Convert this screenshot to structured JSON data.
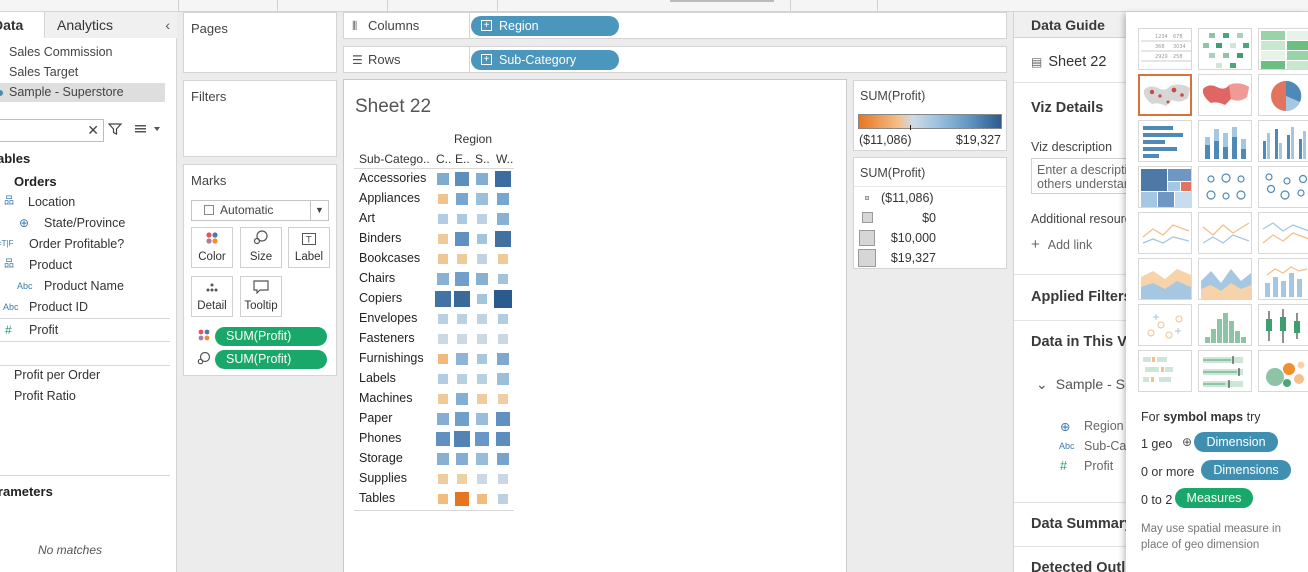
{
  "left_panel": {
    "tab_data": "Data",
    "tab_analytics": "Analytics",
    "datasources": [
      "Sales Commission",
      "Sales Target",
      "Sample - Superstore"
    ],
    "tables_heading": "Tables",
    "orders": "Orders",
    "fields": [
      {
        "label": "Location",
        "icon": "hierarchy-icon"
      },
      {
        "label": "State/Province",
        "icon": "globe-icon"
      },
      {
        "label": "Order Profitable?",
        "icon": "calc-dimension-icon"
      },
      {
        "label": "Product",
        "icon": "hierarchy-icon"
      },
      {
        "label": "Product Name",
        "icon": "abc-icon"
      },
      {
        "label": "Product ID",
        "icon": "abc-icon"
      },
      {
        "label": "Profit",
        "icon": "hash-icon"
      }
    ],
    "measures": [
      "Profit per Order",
      "Profit Ratio"
    ],
    "parameters_heading": "Parameters",
    "no_matches": "No matches"
  },
  "cards": {
    "pages": "Pages",
    "filters": "Filters",
    "marks": "Marks",
    "mark_type": "Automatic",
    "buttons": [
      "Color",
      "Size",
      "Label",
      "Detail",
      "Tooltip"
    ],
    "pills": [
      "SUM(Profit)",
      "SUM(Profit)"
    ]
  },
  "shelves": {
    "columns_label": "Columns",
    "columns_pill": "Region",
    "rows_label": "Rows",
    "rows_pill": "Sub-Category"
  },
  "sheet": {
    "title": "Sheet 22",
    "column_header": "Region",
    "row_header": "Sub-Catego..",
    "col_labels": [
      "C..",
      "E..",
      "S..",
      "W.."
    ]
  },
  "chart_data": {
    "type": "heatmap",
    "title": "Sheet 22",
    "xlabel": "Region",
    "ylabel": "Sub-Catego..",
    "columns": [
      "C..",
      "E..",
      "S..",
      "W.."
    ],
    "rows": [
      "Accessories",
      "Appliances",
      "Art",
      "Binders",
      "Bookcases",
      "Chairs",
      "Copiers",
      "Envelopes",
      "Fasteners",
      "Furnishings",
      "Labels",
      "Machines",
      "Paper",
      "Phones",
      "Storage",
      "Supplies",
      "Tables"
    ],
    "values": [
      [
        7300,
        11500,
        7000,
        16500
      ],
      [
        -2500,
        8000,
        4500,
        8000
      ],
      [
        2500,
        3000,
        1500,
        6500
      ],
      [
        -1500,
        11000,
        3900,
        16000
      ],
      [
        -1800,
        -1200,
        1300,
        -1500
      ],
      [
        6500,
        9000,
        6600,
        4000
      ],
      [
        15600,
        17000,
        3700,
        19300
      ],
      [
        1800,
        1800,
        1400,
        2500
      ],
      [
        250,
        250,
        200,
        300
      ],
      [
        -3900,
        5900,
        3400,
        7600
      ],
      [
        2500,
        2000,
        2000,
        4500
      ],
      [
        -1500,
        6900,
        -1000,
        -500
      ],
      [
        6900,
        9000,
        4700,
        11000
      ],
      [
        11000,
        13000,
        9900,
        11600
      ],
      [
        6600,
        7000,
        4900,
        8300
      ],
      [
        -1000,
        -400,
        200,
        400
      ],
      [
        -3600,
        -11086,
        -3500,
        1500
      ]
    ],
    "color_legend": {
      "title": "SUM(Profit)",
      "min": -11086,
      "max": 19327,
      "min_label": "($11,086)",
      "max_label": "$19,327"
    },
    "size_legend": {
      "title": "SUM(Profit)",
      "items": [
        {
          "label": "($11,086)",
          "value": -11086
        },
        {
          "label": "$0",
          "value": 0
        },
        {
          "label": "$10,000",
          "value": 10000
        },
        {
          "label": "$19,327",
          "value": 19327
        }
      ]
    }
  },
  "data_guide": {
    "title": "Data Guide",
    "sheet_name": "Sheet 22",
    "viz_details": "Viz Details",
    "viz_description_label": "Viz description",
    "viz_description_placeholder": "Enter a description to help others understand this viz",
    "additional_resources": "Additional resources",
    "add_link": "Add link",
    "applied_filters": "Applied Filters",
    "data_in_viz": "Data in This Viz",
    "datasource": "Sample - Superstore",
    "fields": [
      {
        "label": "Region",
        "icon": "globe-icon"
      },
      {
        "label": "Sub-Category",
        "icon": "abc-icon"
      },
      {
        "label": "Profit",
        "icon": "hash-icon"
      }
    ],
    "data_summary": "Data Summary",
    "detected_outliers": "Detected Outliers"
  },
  "show_me": {
    "for_prefix": "For ",
    "for_bold": "symbol maps",
    "for_suffix": " try",
    "req": [
      {
        "count": "1 geo",
        "pill": "Dimension",
        "color": "#3f8fb1"
      },
      {
        "count": "0 or more",
        "pill": "Dimensions",
        "color": "#3f8fb1"
      },
      {
        "count": "0 to 2",
        "pill": "Measures",
        "color": "#1aa86a"
      }
    ],
    "note": "May use spatial measure in place of geo dimension"
  },
  "colors": {
    "accent_green": "#1aa86a",
    "accent_blue": "#4a96bd",
    "negative": "#e8751f",
    "positive": "#2a5b8c"
  }
}
